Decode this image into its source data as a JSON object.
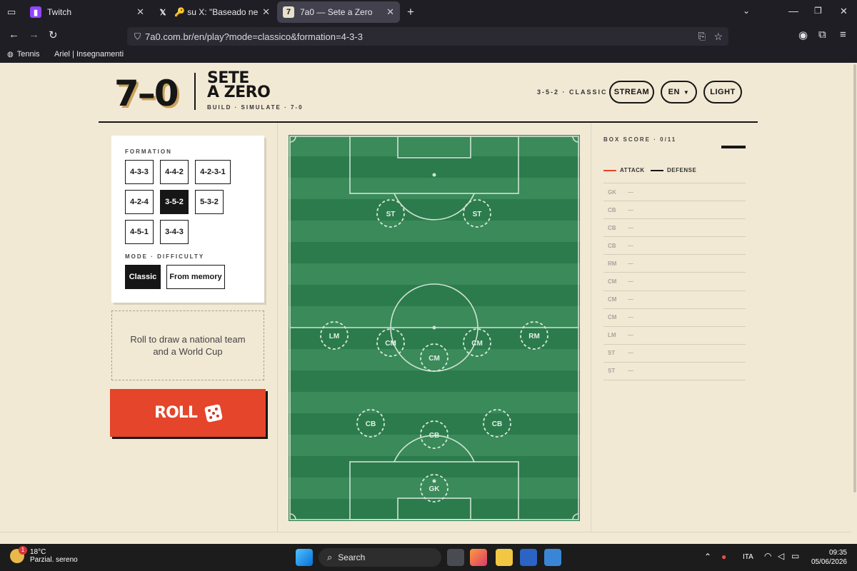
{
  "browser": {
    "tabs": [
      {
        "title": "Twitch",
        "favicon": "twitch-icon",
        "active": false
      },
      {
        "title": "🔑 su X: \"Baseado nesse jogo &",
        "favicon": "x-icon",
        "active": false
      },
      {
        "title": "7a0 — Sete a Zero",
        "favicon": "7a0-icon",
        "active": true
      }
    ],
    "url": "7a0.com.br/en/play?mode=classico&formation=4-3-3",
    "bookmarks": [
      "Tennis",
      "Ariel | Insegnamenti"
    ]
  },
  "header": {
    "logo_number": "7–0",
    "logo_title_line1": "SETE",
    "logo_title_line2": "A ZERO",
    "logo_sub": "BUILD · SIMULATE · 7-0",
    "info": "3-5-2 · CLASSIC",
    "stream_label": "STREAM",
    "lang_label": "EN",
    "theme_label": "LIGHT"
  },
  "sidebar": {
    "formation_label": "FORMATION",
    "formations": [
      "4-3-3",
      "4-4-2",
      "4-2-3-1",
      "4-2-4",
      "3-5-2",
      "5-3-2",
      "4-5-1",
      "3-4-3"
    ],
    "active_formation": "3-5-2",
    "mode_label": "MODE · DIFFICULTY",
    "modes": [
      "Classic",
      "From memory"
    ],
    "active_mode": "Classic",
    "draw_text": "Roll to draw a national team and a World Cup",
    "roll_label": "ROLL"
  },
  "pitch": {
    "players": [
      "ST",
      "ST",
      "LM",
      "CM",
      "CM",
      "CM",
      "RM",
      "CB",
      "CB",
      "CB",
      "GK"
    ]
  },
  "box_score": {
    "title": "BOX SCORE · 0/11",
    "legend_attack": "ATTACK",
    "legend_defense": "DEFENSE",
    "attack_color": "#e4452b",
    "defense_color": "#161616",
    "rows": [
      {
        "pos": "GK",
        "val": "—"
      },
      {
        "pos": "CB",
        "val": "—"
      },
      {
        "pos": "CB",
        "val": "—"
      },
      {
        "pos": "CB",
        "val": "—"
      },
      {
        "pos": "RM",
        "val": "—"
      },
      {
        "pos": "CM",
        "val": "—"
      },
      {
        "pos": "CM",
        "val": "—"
      },
      {
        "pos": "CM",
        "val": "—"
      },
      {
        "pos": "LM",
        "val": "—"
      },
      {
        "pos": "ST",
        "val": "—"
      },
      {
        "pos": "ST",
        "val": "—"
      }
    ]
  },
  "taskbar": {
    "temp": "18°C",
    "weather": "Parzial. sereno",
    "search": "Search",
    "lang": "ITA",
    "time": "09:35",
    "date": "05/06/2026",
    "notification_count": "1"
  }
}
